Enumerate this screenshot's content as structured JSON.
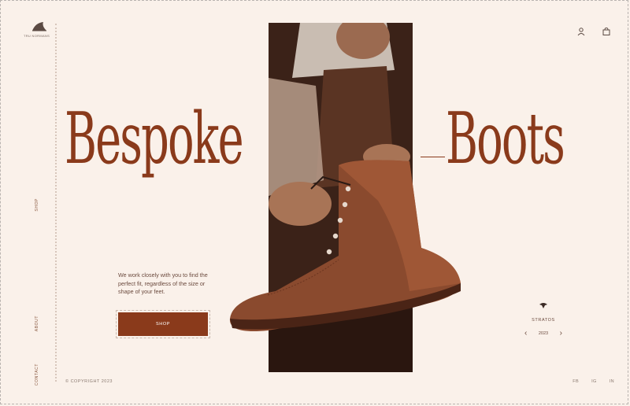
{
  "brand": {
    "logo_text": "TRU NORMANS"
  },
  "nav": {
    "shop": "SHOP",
    "about": "ABOUT",
    "contact": "CONTACT"
  },
  "hero": {
    "word_left": "Bespoke",
    "word_right": "Boots"
  },
  "content": {
    "description": "We work closely with you to find the perfect fit, regardless of the size or shape of your feet.",
    "shop_button": "SHOP"
  },
  "collection": {
    "name": "STRATOS",
    "year": "2023"
  },
  "footer": {
    "copyright": "© COPYRIGHT 2023",
    "social": [
      "FB",
      "IG",
      "IN"
    ]
  },
  "colors": {
    "background": "#faf1ea",
    "accent": "#8a3a1b",
    "text": "#6b4a3e"
  },
  "icons": {
    "account": "user-icon",
    "cart": "cart-icon",
    "prev": "chevron-left-icon",
    "next": "chevron-right-icon"
  }
}
